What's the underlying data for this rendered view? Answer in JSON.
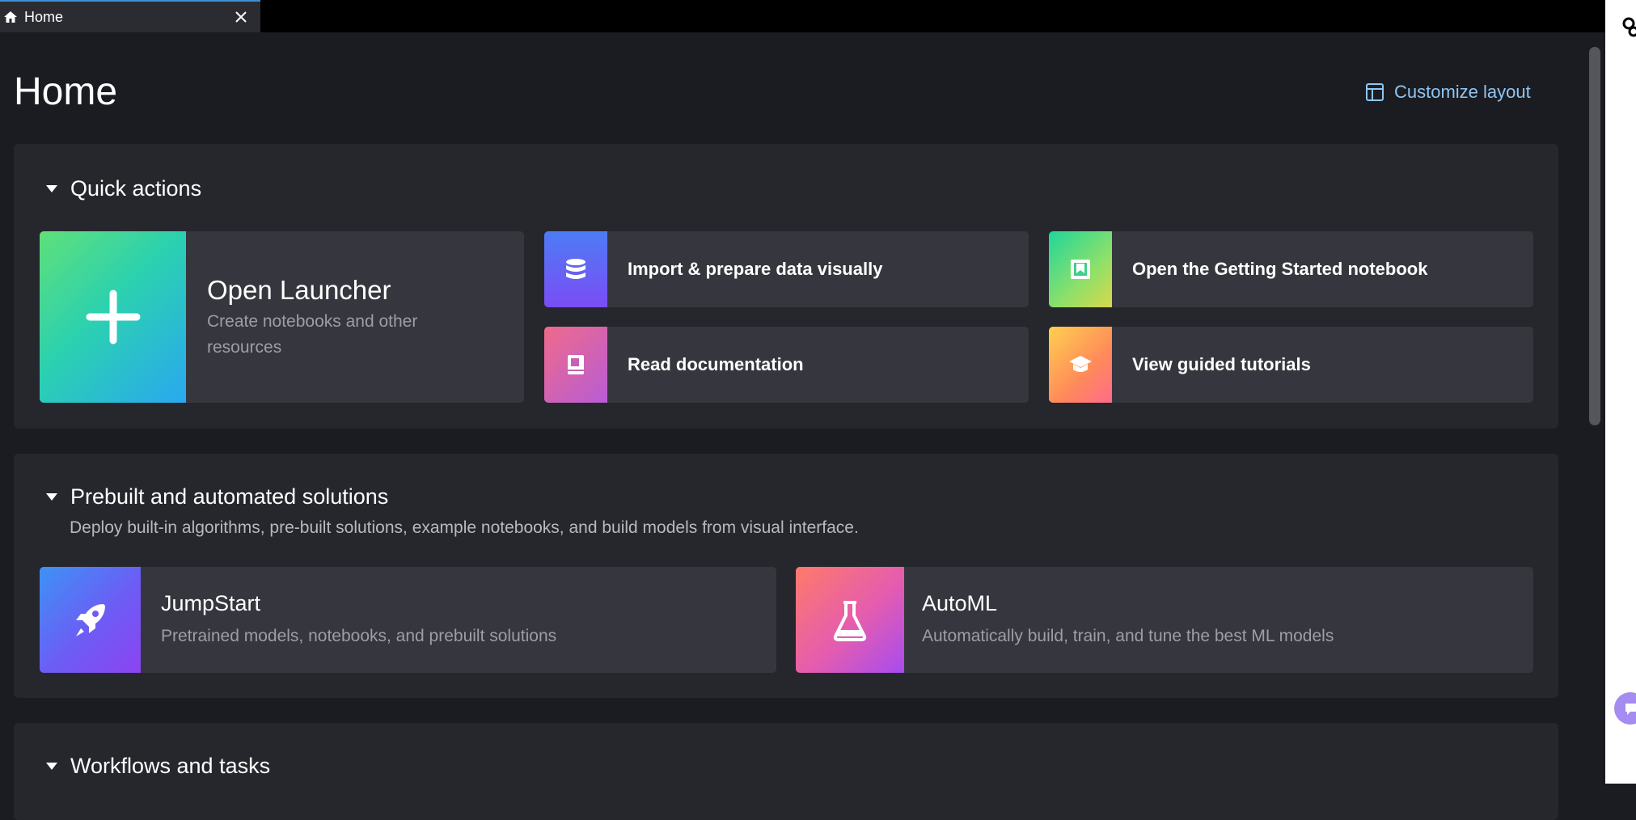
{
  "tab": {
    "label": "Home"
  },
  "header": {
    "title": "Home",
    "customize_label": "Customize layout"
  },
  "quick_actions": {
    "title": "Quick actions",
    "launcher": {
      "title": "Open Launcher",
      "subtitle": "Create notebooks and other resources"
    },
    "items": [
      {
        "label": "Import & prepare data visually",
        "icon": "database-icon"
      },
      {
        "label": "Open the Getting Started notebook",
        "icon": "notebook-icon"
      },
      {
        "label": "Read documentation",
        "icon": "book-icon"
      },
      {
        "label": "View guided tutorials",
        "icon": "graduation-cap-icon"
      }
    ]
  },
  "prebuilt": {
    "title": "Prebuilt and automated solutions",
    "description": "Deploy built-in algorithms, pre-built solutions, example notebooks, and build models from visual interface.",
    "cards": [
      {
        "title": "JumpStart",
        "subtitle": "Pretrained models, notebooks, and prebuilt solutions",
        "icon": "rocket-icon"
      },
      {
        "title": "AutoML",
        "subtitle": "Automatically build, train, and tune the best ML models",
        "icon": "flask-icon"
      }
    ]
  },
  "workflows": {
    "title": "Workflows and tasks"
  },
  "colors": {
    "accent_link": "#8fc5f2",
    "panel": "#26272d",
    "card": "#36373e",
    "background": "#1b1c21"
  }
}
